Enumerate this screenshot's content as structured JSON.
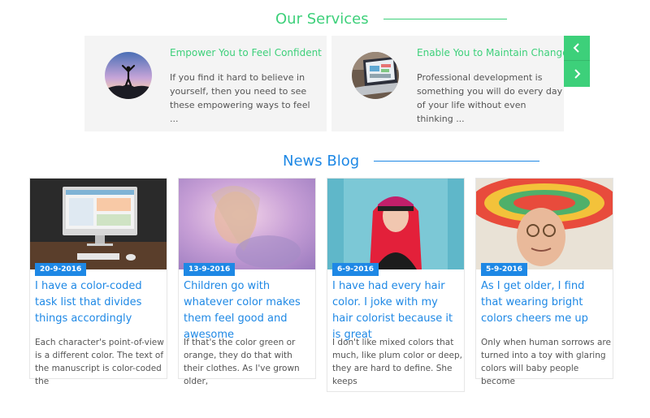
{
  "services": {
    "title": "Our Services",
    "cards": [
      {
        "heading": "Empower You to Feel Confident",
        "description": "If you find it hard to believe in yourself, then you need to see these empowering ways to feel ...",
        "image": "person-on-summit-photo"
      },
      {
        "heading": "Enable You to Maintain Changes",
        "description": "Professional development is something you will do every day of your life without even thinking ...",
        "image": "laptop-dashboard-photo"
      }
    ],
    "prev_icon": "chevron-left-icon",
    "next_icon": "chevron-right-icon"
  },
  "blog": {
    "title": "News Blog",
    "posts": [
      {
        "date": "20-9-2016",
        "title": "I have a color-coded task list that divides things accordingly",
        "excerpt": "Each character's point-of-view is a different color. The text of the manuscript is color-coded the",
        "image": "desktop-computer-photo"
      },
      {
        "date": "13-9-2016",
        "title": "Children go with whatever color makes them feel good and awesome",
        "excerpt": "If that's the color green or orange, they do that with their clothes. As I've grown older,",
        "image": "blurred-girl-photo"
      },
      {
        "date": "6-9-2016",
        "title": "I have had every hair color. I joke with my hair colorist because it is great",
        "excerpt": "I don't like mixed colors that much, like plum color or deep, they are hard to define. She keeps",
        "image": "red-haired-woman-photo"
      },
      {
        "date": "5-9-2016",
        "title": "As I get older, I find that wearing bright colors cheers me up",
        "excerpt": "Only when human sorrows are turned into a toy with glaring colors will baby people become",
        "image": "woman-with-sombrero-photo"
      }
    ]
  },
  "colors": {
    "services_accent": "#3dd07a",
    "blog_accent": "#1e88e5",
    "card_background": "#f4f4f4"
  }
}
